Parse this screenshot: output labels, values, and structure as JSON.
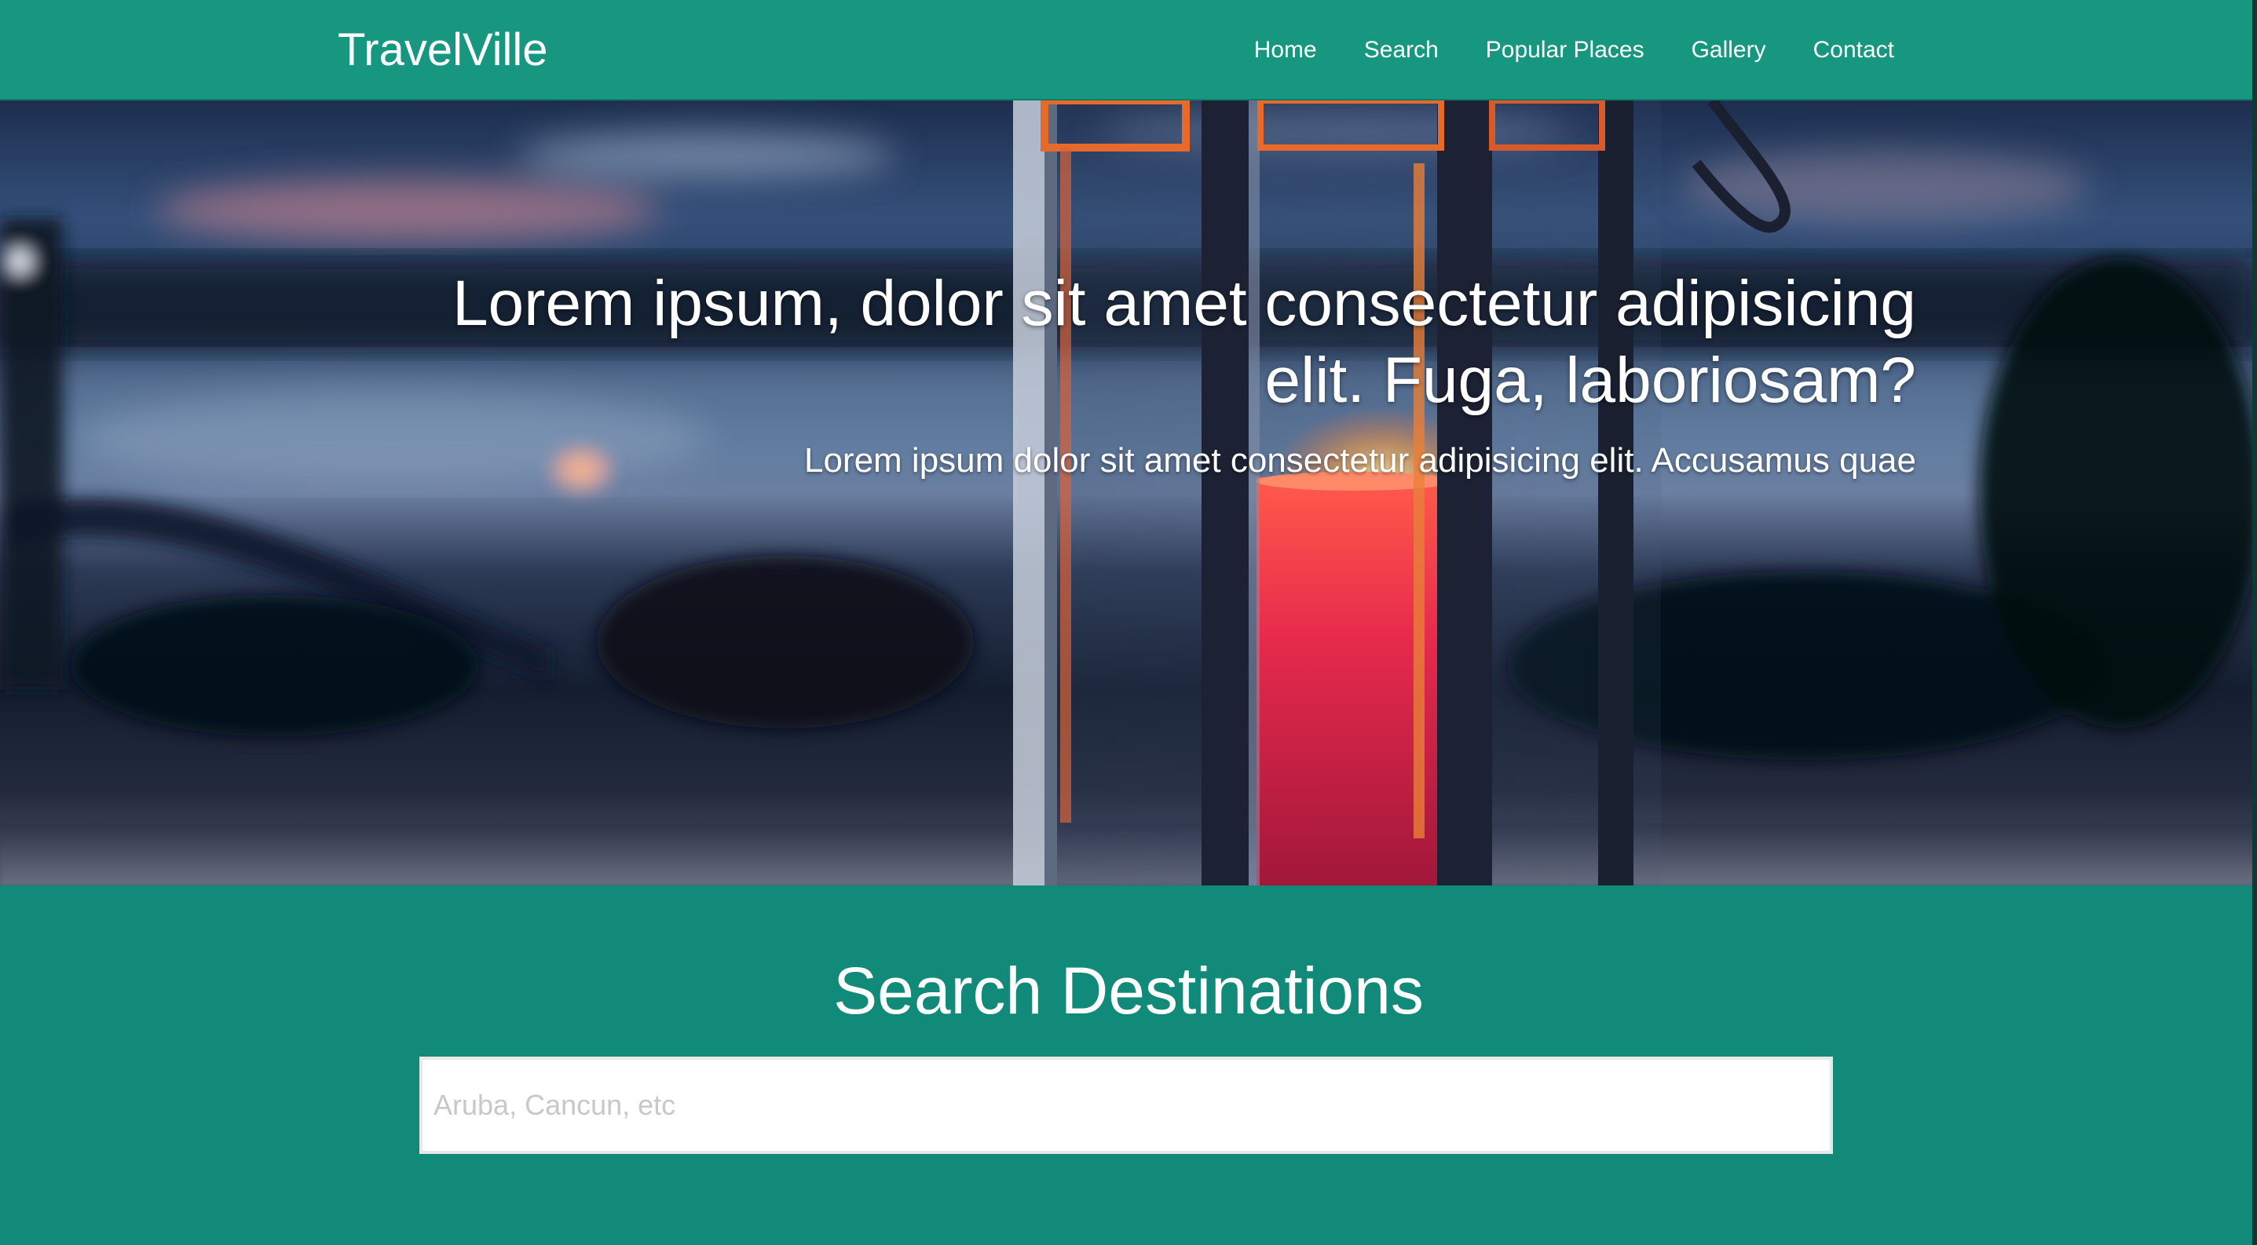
{
  "navbar": {
    "brand": "TravelVille",
    "links": [
      {
        "label": "Home"
      },
      {
        "label": "Search"
      },
      {
        "label": "Popular Places"
      },
      {
        "label": "Gallery"
      },
      {
        "label": "Contact"
      }
    ]
  },
  "hero": {
    "title": "Lorem ipsum, dolor sit amet consectetur adipisicing elit. Fuga, laboriosam?",
    "subtitle": "Lorem ipsum dolor sit amet consectetur adipisicing elit. Accusamus quae"
  },
  "search": {
    "title": "Search Destinations",
    "placeholder": "Aruba, Cancun, etc",
    "value": ""
  },
  "colors": {
    "navbar": "#17977f",
    "section": "#128a7a",
    "text": "#ffffff"
  }
}
